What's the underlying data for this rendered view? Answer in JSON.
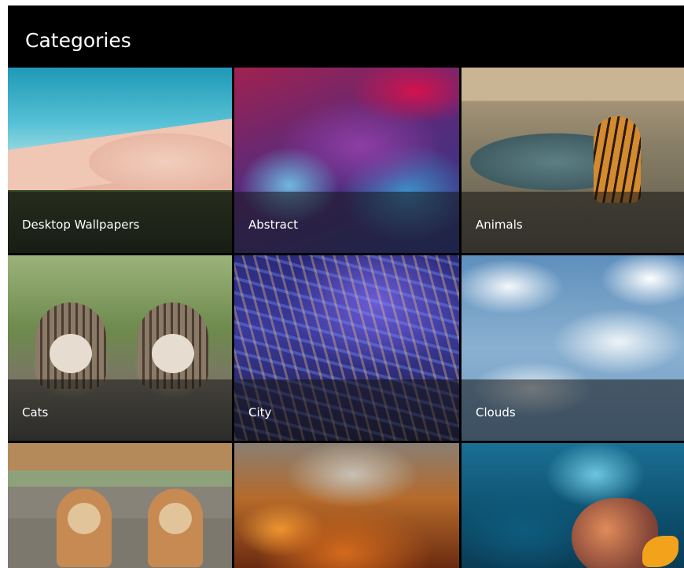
{
  "header": {
    "title": "Categories"
  },
  "categories": [
    {
      "label": "Desktop Wallpapers"
    },
    {
      "label": "Abstract"
    },
    {
      "label": "Animals"
    },
    {
      "label": "Cats"
    },
    {
      "label": "City"
    },
    {
      "label": "Clouds"
    },
    {
      "label": ""
    },
    {
      "label": ""
    },
    {
      "label": ""
    }
  ]
}
